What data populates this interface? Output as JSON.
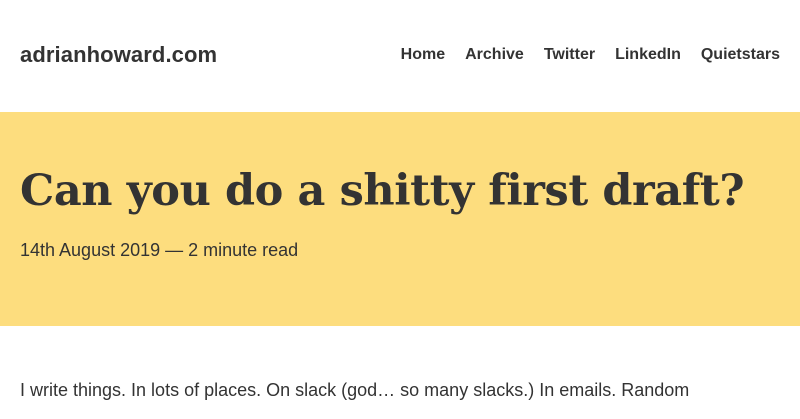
{
  "header": {
    "site_title": "adrianhoward.com",
    "nav": [
      {
        "label": "Home"
      },
      {
        "label": "Archive"
      },
      {
        "label": "Twitter"
      },
      {
        "label": "LinkedIn"
      },
      {
        "label": "Quietstars"
      }
    ]
  },
  "post": {
    "title": "Can you do a shitty first draft?",
    "meta": "14th August 2019 — 2 minute read",
    "first_line": "I write things. In lots of places. On slack (god… so many slacks.) In emails. Random"
  },
  "colors": {
    "hero_background": "#fddd7e",
    "text": "#333333"
  }
}
